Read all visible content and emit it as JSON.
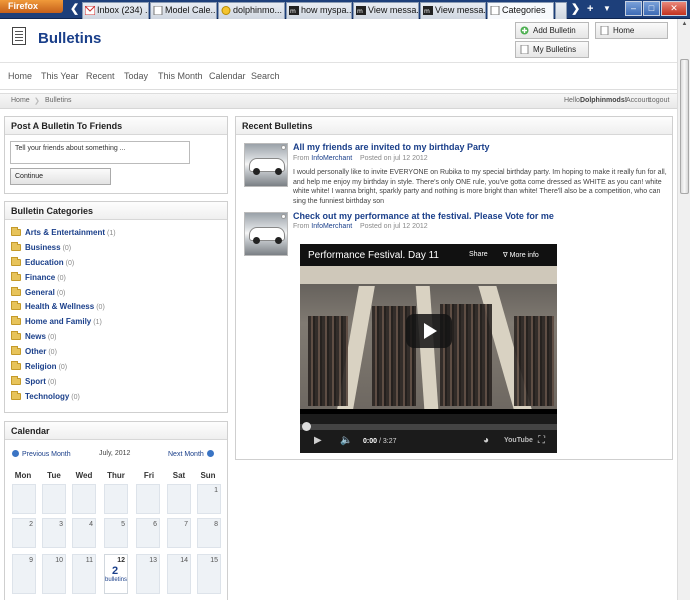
{
  "browser": {
    "app_button": "Firefox",
    "tabs": [
      {
        "label": "Inbox (234) ..."
      },
      {
        "label": "Model Cale..."
      },
      {
        "label": "dolphinmo..."
      },
      {
        "label": "how myspa..."
      },
      {
        "label": "View messa..."
      },
      {
        "label": "View messa..."
      },
      {
        "label": "Categories"
      }
    ]
  },
  "header": {
    "title": "Bulletins",
    "add_bulletin": "Add Bulletin",
    "home": "Home",
    "my_bulletins": "My Bulletins"
  },
  "nav": [
    "Home",
    "This Year",
    "Recent",
    "Today",
    "This Month",
    "Calendar",
    "Search"
  ],
  "breadcrumb": {
    "home": "Home",
    "current": "Bulletins",
    "greeting": "Hello,",
    "user": "Dolphinmods!",
    "account": "Account",
    "logout": "Logout"
  },
  "post_panel": {
    "title": "Post A Bulletin To Friends",
    "input_value": "Tell your friends about something ...",
    "button": "Continue"
  },
  "categories_panel": {
    "title": "Bulletin Categories",
    "items": [
      {
        "name": "Arts & Entertainment",
        "count": "(1)"
      },
      {
        "name": "Business",
        "count": "(0)"
      },
      {
        "name": "Education",
        "count": "(0)"
      },
      {
        "name": "Finance",
        "count": "(0)"
      },
      {
        "name": "General",
        "count": "(0)"
      },
      {
        "name": "Health & Wellness",
        "count": "(0)"
      },
      {
        "name": "Home and Family",
        "count": "(1)"
      },
      {
        "name": "News",
        "count": "(0)"
      },
      {
        "name": "Other",
        "count": "(0)"
      },
      {
        "name": "Religion",
        "count": "(0)"
      },
      {
        "name": "Sport",
        "count": "(0)"
      },
      {
        "name": "Technology",
        "count": "(0)"
      }
    ]
  },
  "calendar": {
    "title": "Calendar",
    "prev": "Previous Month",
    "month": "July, 2012",
    "next": "Next Month",
    "weekdays": [
      "Mon",
      "Tue",
      "Wed",
      "Thur",
      "Fri",
      "Sat",
      "Sun"
    ],
    "days": [
      "1",
      "2",
      "3",
      "4",
      "5",
      "6",
      "7",
      "8",
      "9",
      "10",
      "11",
      "12",
      "13",
      "14",
      "15"
    ],
    "today_count": "2",
    "today_label": "bulletins"
  },
  "recent": {
    "title": "Recent Bulletins",
    "from_label": "From",
    "posted_label": "Posted on",
    "items": [
      {
        "title": "All my friends are invited to my birthday Party",
        "author": "InfoMerchant",
        "date": "jul 12 2012",
        "body": "I would personally like to invite EVERYONE on Rubika to my special birthday party. Im hoping to make it really fun for all, and help me enjoy my birthday in style. There's only ONE rule, you've gotta come dressed as WHITE as you can! white white white! I wanna bright, sparkly party and nothing is more bright than white! There'll also be a competition, who can sing the funniest birthday son"
      },
      {
        "title": "Check out my performance at the festival. Please Vote for me",
        "author": "InfoMerchant",
        "date": "jul 12 2012"
      }
    ]
  },
  "video": {
    "title": "Performance Festival. Day 11",
    "share": "Share",
    "more_info": "More info",
    "time_current": "0:00",
    "time_total": "/ 3:27",
    "brand": "YouTube"
  },
  "colors": {
    "link": "#1a3f8a",
    "folder": "#e7c35a",
    "tabbar": "#1d3f7a"
  }
}
